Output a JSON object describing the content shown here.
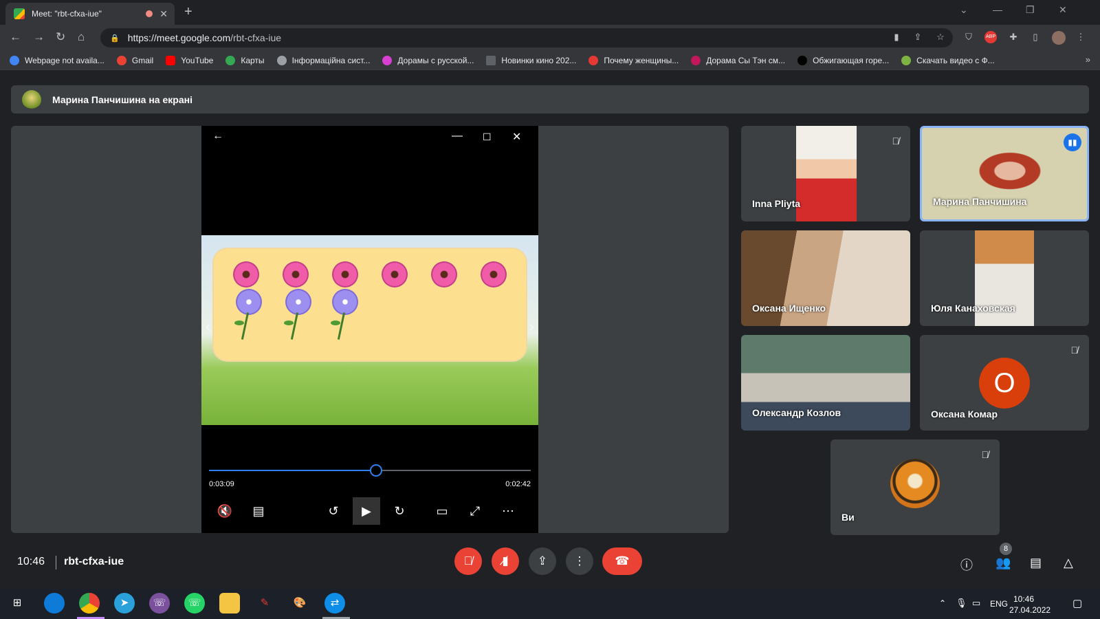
{
  "browser": {
    "tab_title": "Meet: \"rbt-cfxa-iue\"",
    "url_host": "https://meet.google.com",
    "url_path": "/rbt-cfxa-iue",
    "bookmarks": [
      {
        "label": "Webpage not availa...",
        "color": "#4285f4"
      },
      {
        "label": "Gmail",
        "color": "#ea4335"
      },
      {
        "label": "YouTube",
        "color": "#ff0000"
      },
      {
        "label": "Карты",
        "color": "#34a853"
      },
      {
        "label": "Інформаційна сист...",
        "color": "#9aa0a6"
      },
      {
        "label": "Дорамы с русской...",
        "color": "#d93fd0"
      },
      {
        "label": "Новинки кино 202...",
        "color": "#5f6368"
      },
      {
        "label": "Почему женщины...",
        "color": "#e53935"
      },
      {
        "label": "Дорама Сы Тэн см...",
        "color": "#c2185b"
      },
      {
        "label": "Обжигающая горе...",
        "color": "#000000"
      },
      {
        "label": "Скачать видео с Ф...",
        "color": "#7cb342"
      }
    ],
    "more_bookmarks": "»"
  },
  "banner": {
    "text": "Марина Панчишина на екрані"
  },
  "player": {
    "elapsed": "0:03:09",
    "remaining": "0:02:42",
    "progress": 0.52
  },
  "participants": [
    {
      "name": "Inna Pliyta",
      "muted": true
    },
    {
      "name": "Марина Панчишина",
      "speaking": true
    },
    {
      "name": "Оксана Ищенко"
    },
    {
      "name": "Юля Канаховская"
    },
    {
      "name": "Олександр Козлов"
    },
    {
      "name": "Оксана Комар",
      "avatar_letter": "О",
      "muted": true
    },
    {
      "name": "Ви",
      "muted": true
    }
  ],
  "meeting": {
    "time": "10:46",
    "code": "rbt-cfxa-iue",
    "people_count": "8"
  },
  "taskbar": {
    "lang": "ENG",
    "time": "10:46",
    "date": "27.04.2022"
  }
}
